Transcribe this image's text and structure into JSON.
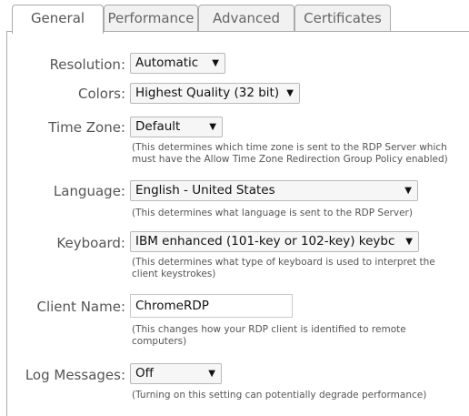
{
  "tabs": [
    {
      "label": "General",
      "active": true
    },
    {
      "label": "Performance",
      "active": false
    },
    {
      "label": "Advanced",
      "active": false
    },
    {
      "label": "Certificates",
      "active": false
    }
  ],
  "fields": {
    "resolution": {
      "label": "Resolution:",
      "value": "Automatic"
    },
    "colors": {
      "label": "Colors:",
      "value": "Highest Quality (32 bit)"
    },
    "timezone": {
      "label": "Time Zone:",
      "value": "Default",
      "help_line1": "(This determines which time zone is sent to the RDP Server which",
      "help_line2": "must have the Allow Time Zone Redirection Group Policy enabled)"
    },
    "language": {
      "label": "Language:",
      "value": "English - United States",
      "help_line1": "(This determines what language is sent to the RDP Server)"
    },
    "keyboard": {
      "label": "Keyboard:",
      "value": "IBM enhanced (101-key or 102-key) keybc",
      "help_line1": "(This determines what type of keyboard is used to interpret the",
      "help_line2": "client keystrokes)"
    },
    "client_name": {
      "label": "Client Name:",
      "value": "ChromeRDP",
      "help_line1": "(This changes how your RDP client is identified to remote",
      "help_line2": "computers)"
    },
    "log_messages": {
      "label": "Log Messages:",
      "value": "Off",
      "help_line1": "(Turning on this setting can potentially degrade performance)"
    }
  },
  "icons": {
    "dropdown": "chevron-down-icon"
  }
}
